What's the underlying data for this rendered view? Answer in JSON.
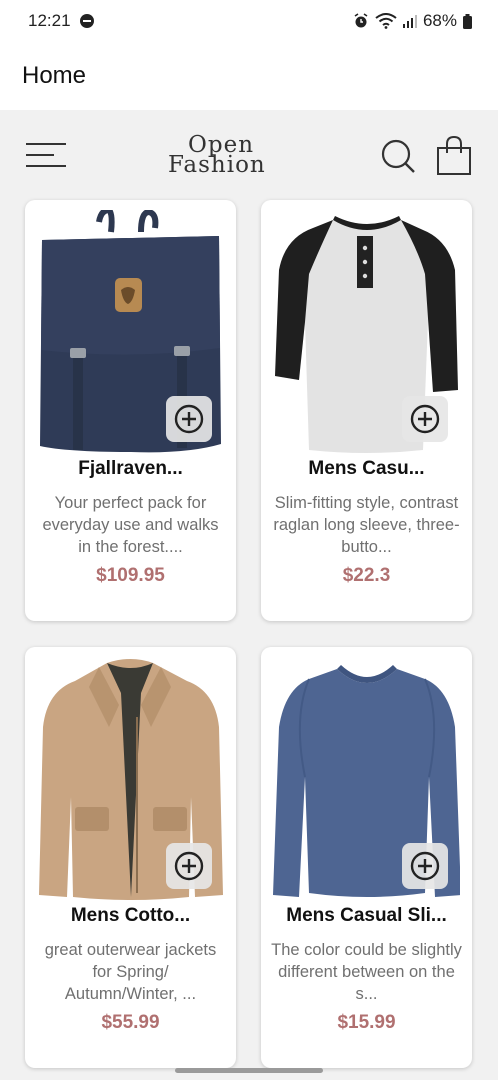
{
  "status_bar": {
    "time": "12:21",
    "battery": "68%"
  },
  "app_bar": {
    "title": "Home"
  },
  "brand": {
    "line1": "Open",
    "line2": "Fashion"
  },
  "products": [
    {
      "title": "Fjallraven...",
      "description": "Your perfect pack for everyday use and walks in the forest....",
      "price": "$109.95",
      "image": "backpack"
    },
    {
      "title": "Mens Casu...",
      "description": "Slim-fitting style, contrast raglan long sleeve, three-butto...",
      "price": "$22.3",
      "image": "raglan-shirt"
    },
    {
      "title": "Mens Cotto...",
      "description": "great outerwear jackets for Spring/ Autumn/Winter, ...",
      "price": "$55.99",
      "image": "jacket"
    },
    {
      "title": "Mens Casual Sli...",
      "description": "The color could be slightly different between on the s...",
      "price": "$15.99",
      "image": "long-sleeve-tee"
    }
  ],
  "colors": {
    "price": "#b07070",
    "background": "#f1f1f1"
  }
}
